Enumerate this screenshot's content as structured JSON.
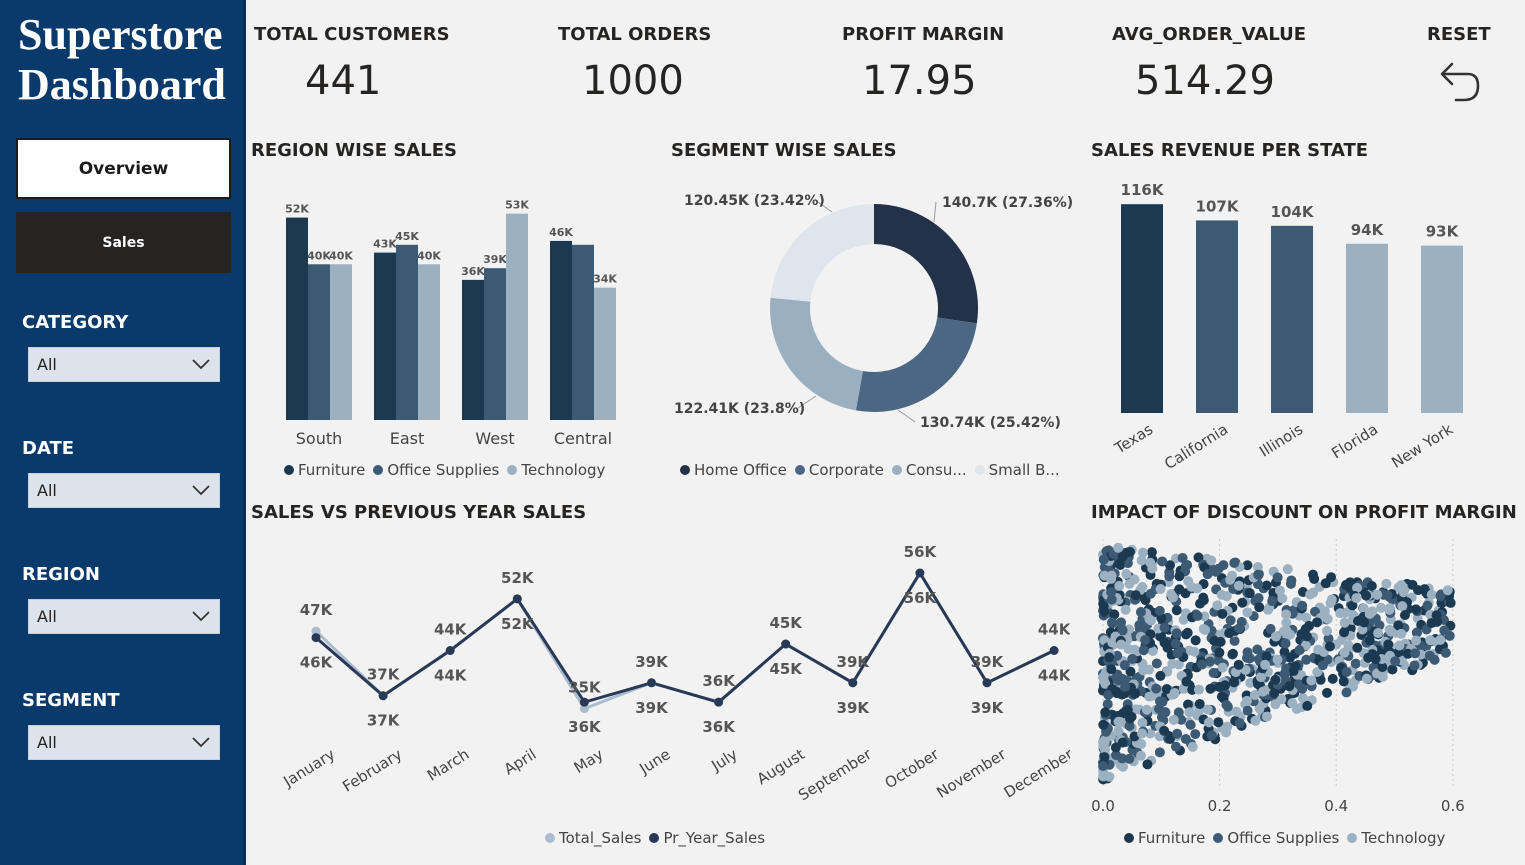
{
  "app": {
    "title_line1": "Superstore",
    "title_line2": "Dashboard"
  },
  "nav": {
    "overview": "Overview",
    "sales": "Sales"
  },
  "filters": [
    {
      "label": "CATEGORY",
      "value": "All"
    },
    {
      "label": "DATE",
      "value": "All"
    },
    {
      "label": "REGION",
      "value": "All"
    },
    {
      "label": "SEGMENT",
      "value": "All"
    }
  ],
  "kpis": [
    {
      "label": "TOTAL CUSTOMERS",
      "value": "441"
    },
    {
      "label": "TOTAL ORDERS",
      "value": "1000"
    },
    {
      "label": "PROFIT MARGIN",
      "value": "17.95"
    },
    {
      "label": "AVG_ORDER_VALUE",
      "value": "514.29"
    }
  ],
  "reset": {
    "label": "RESET",
    "icon": "undo-arrow-icon"
  },
  "colors": {
    "sidebar": "#0a3a6b",
    "dark": "#1b3a52",
    "mid": "#3d5a74",
    "light": "#9bb0c1",
    "donut_dark": "#243249",
    "donut_mid": "#4c6784",
    "donut_light": "#9aafc0",
    "donut_pale": "#dfe5ec",
    "line": "#283955",
    "line_light": "#aabccd"
  },
  "chart_data": [
    {
      "id": "region",
      "type": "bar",
      "title": "REGION WISE SALES",
      "categories": [
        "South",
        "East",
        "West",
        "Central"
      ],
      "series": [
        {
          "name": "Furniture",
          "values": [
            52,
            43,
            36,
            46
          ],
          "labels": [
            "52K",
            "43K",
            "36K",
            "46K"
          ]
        },
        {
          "name": "Office Supplies",
          "values": [
            40,
            45,
            39,
            45
          ],
          "labels": [
            "40K",
            "45K",
            "39K",
            ""
          ]
        },
        {
          "name": "Technology",
          "values": [
            40,
            40,
            53,
            34
          ],
          "labels": [
            "40K",
            "40K",
            "53K",
            "34K"
          ]
        }
      ],
      "ylim": [
        0,
        56
      ]
    },
    {
      "id": "segment",
      "type": "pie",
      "title": "SEGMENT WISE SALES",
      "slices": [
        {
          "name": "Home Office",
          "value": 140.7,
          "label": "140.7K (27.36%)"
        },
        {
          "name": "Corporate",
          "value": 130.74,
          "label": "130.74K (25.42%)"
        },
        {
          "name": "Consumer",
          "value": 122.41,
          "label": "122.41K (23.8%)"
        },
        {
          "name": "Small Business",
          "value": 120.45,
          "label": "120.45K (23.42%)"
        }
      ],
      "legend": [
        "Home Office",
        "Corporate",
        "Consu...",
        "Small B..."
      ]
    },
    {
      "id": "state",
      "type": "bar",
      "title": "SALES REVENUE PER STATE",
      "categories": [
        "Texas",
        "California",
        "Illinois",
        "Florida",
        "New York"
      ],
      "values": [
        116,
        107,
        104,
        94,
        93
      ],
      "labels": [
        "116K",
        "107K",
        "104K",
        "94K",
        "93K"
      ],
      "ylim": [
        0,
        120
      ]
    },
    {
      "id": "sales_line",
      "type": "line",
      "title": "SALES VS PREVIOUS YEAR SALES",
      "x": [
        "January",
        "February",
        "March",
        "April",
        "May",
        "June",
        "July",
        "August",
        "September",
        "October",
        "November",
        "December"
      ],
      "series": [
        {
          "name": "Total_Sales",
          "values": [
            47,
            37,
            44,
            52,
            35,
            39,
            36,
            45,
            39,
            56,
            39,
            44
          ],
          "labels": [
            "47K",
            "37K",
            "44K",
            "52K",
            "35K",
            "39K",
            "36K",
            "45K",
            "39K",
            "56K",
            "39K",
            "44K"
          ]
        },
        {
          "name": "Pr_Year_Sales",
          "values": [
            46,
            37,
            44,
            52,
            36,
            39,
            36,
            45,
            39,
            56,
            39,
            44
          ],
          "labels": [
            "46K",
            "37K",
            "44K",
            "52K",
            "36K",
            "39K",
            "36K",
            "45K",
            "39K",
            "56K",
            "39K",
            "44K"
          ]
        }
      ],
      "ylim": [
        32,
        58
      ]
    },
    {
      "id": "discount",
      "type": "scatter",
      "title": "IMPACT OF DISCOUNT ON PROFIT MARGIN",
      "xlim": [
        0,
        0.65
      ],
      "x_ticks": [
        "0.0",
        "0.2",
        "0.4",
        "0.6"
      ],
      "series": [
        "Furniture",
        "Office Supplies",
        "Technology"
      ],
      "n_points": 1000
    }
  ]
}
